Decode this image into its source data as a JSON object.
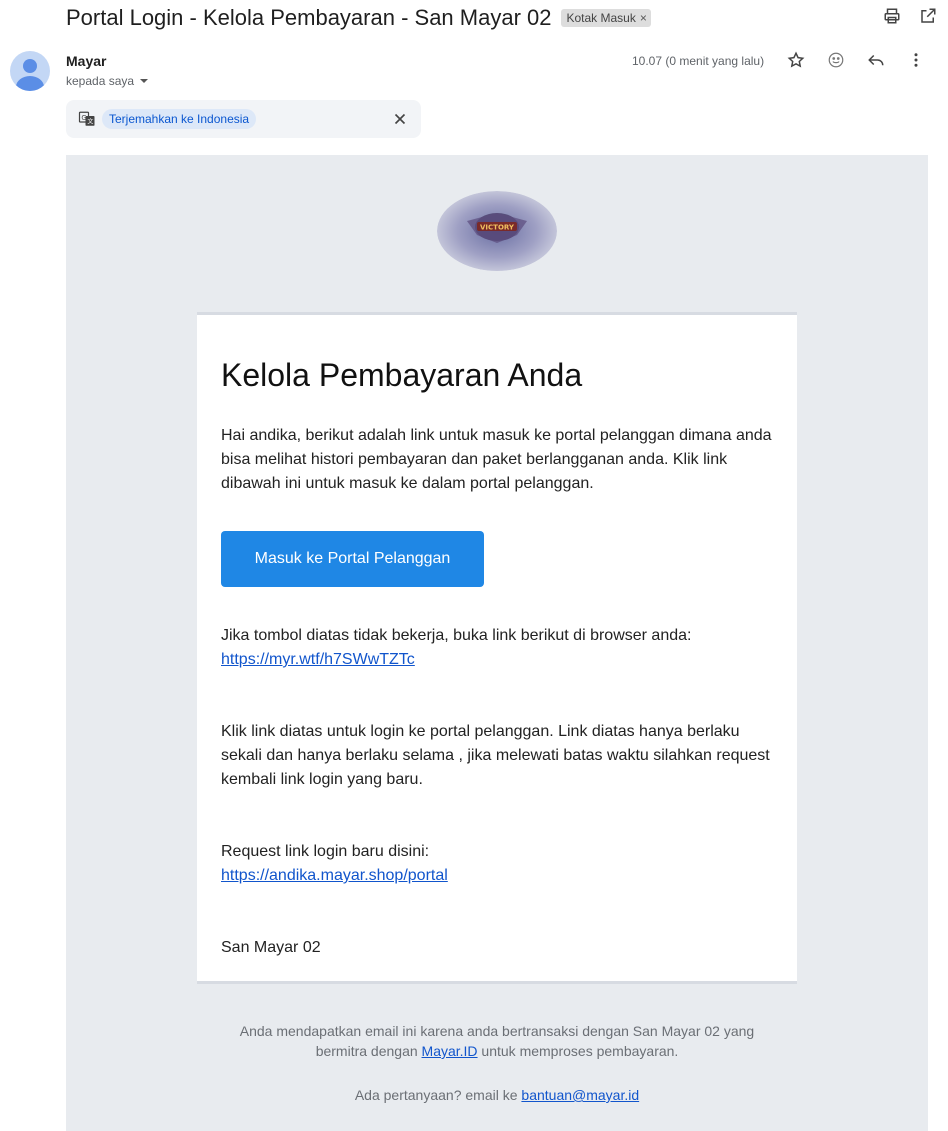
{
  "header": {
    "subject": "Portal Login - Kelola Pembayaran - San Mayar 02",
    "label_chip": "Kotak Masuk",
    "label_close": "×"
  },
  "message": {
    "sender_name": "Mayar",
    "recipient": "kepada saya",
    "time": "10.07 (0 menit yang lalu)"
  },
  "translate": {
    "link_label": "Terjemahkan ke Indonesia"
  },
  "email": {
    "heading": "Kelola Pembayaran Anda",
    "intro": "Hai andika, berikut adalah link untuk masuk ke portal pelanggan dimana anda bisa melihat histori pembayaran dan paket berlangganan anda. Klik link dibawah ini untuk masuk ke dalam portal pelanggan.",
    "cta_label": "Masuk ke Portal Pelanggan",
    "fallback_text": "Jika tombol diatas tidak bekerja, buka link berikut di browser anda:",
    "fallback_link": "https://myr.wtf/h7SWwTZTc",
    "expiry_text": "Klik link diatas untuk login ke portal pelanggan. Link diatas hanya berlaku sekali dan hanya berlaku selama , jika melewati batas waktu silahkan request kembali link login yang baru.",
    "request_text": "Request link login baru disini:",
    "request_link": "https://andika.mayar.shop/portal",
    "signature": "San Mayar 02"
  },
  "footer": {
    "line1_a": "Anda mendapatkan email ini karena anda bertransaksi dengan San Mayar 02 yang bermitra dengan ",
    "line1_link": "Mayar.ID",
    "line1_b": " untuk memproses pembayaran.",
    "line2_a": "Ada pertanyaan? email ke ",
    "line2_link": "bantuan@mayar.id"
  },
  "icons": [
    "print-icon",
    "open-in-new-window-icon",
    "star-icon",
    "emoji-icon",
    "reply-icon",
    "more-vert-icon",
    "translate-icon",
    "close-icon",
    "chevron-down-icon",
    "avatar-person-icon"
  ],
  "colors": {
    "cta_bg": "#1f87e5",
    "email_bg": "#e8ebef",
    "link": "#1155cc",
    "translate_chip": "#dde8f8"
  }
}
